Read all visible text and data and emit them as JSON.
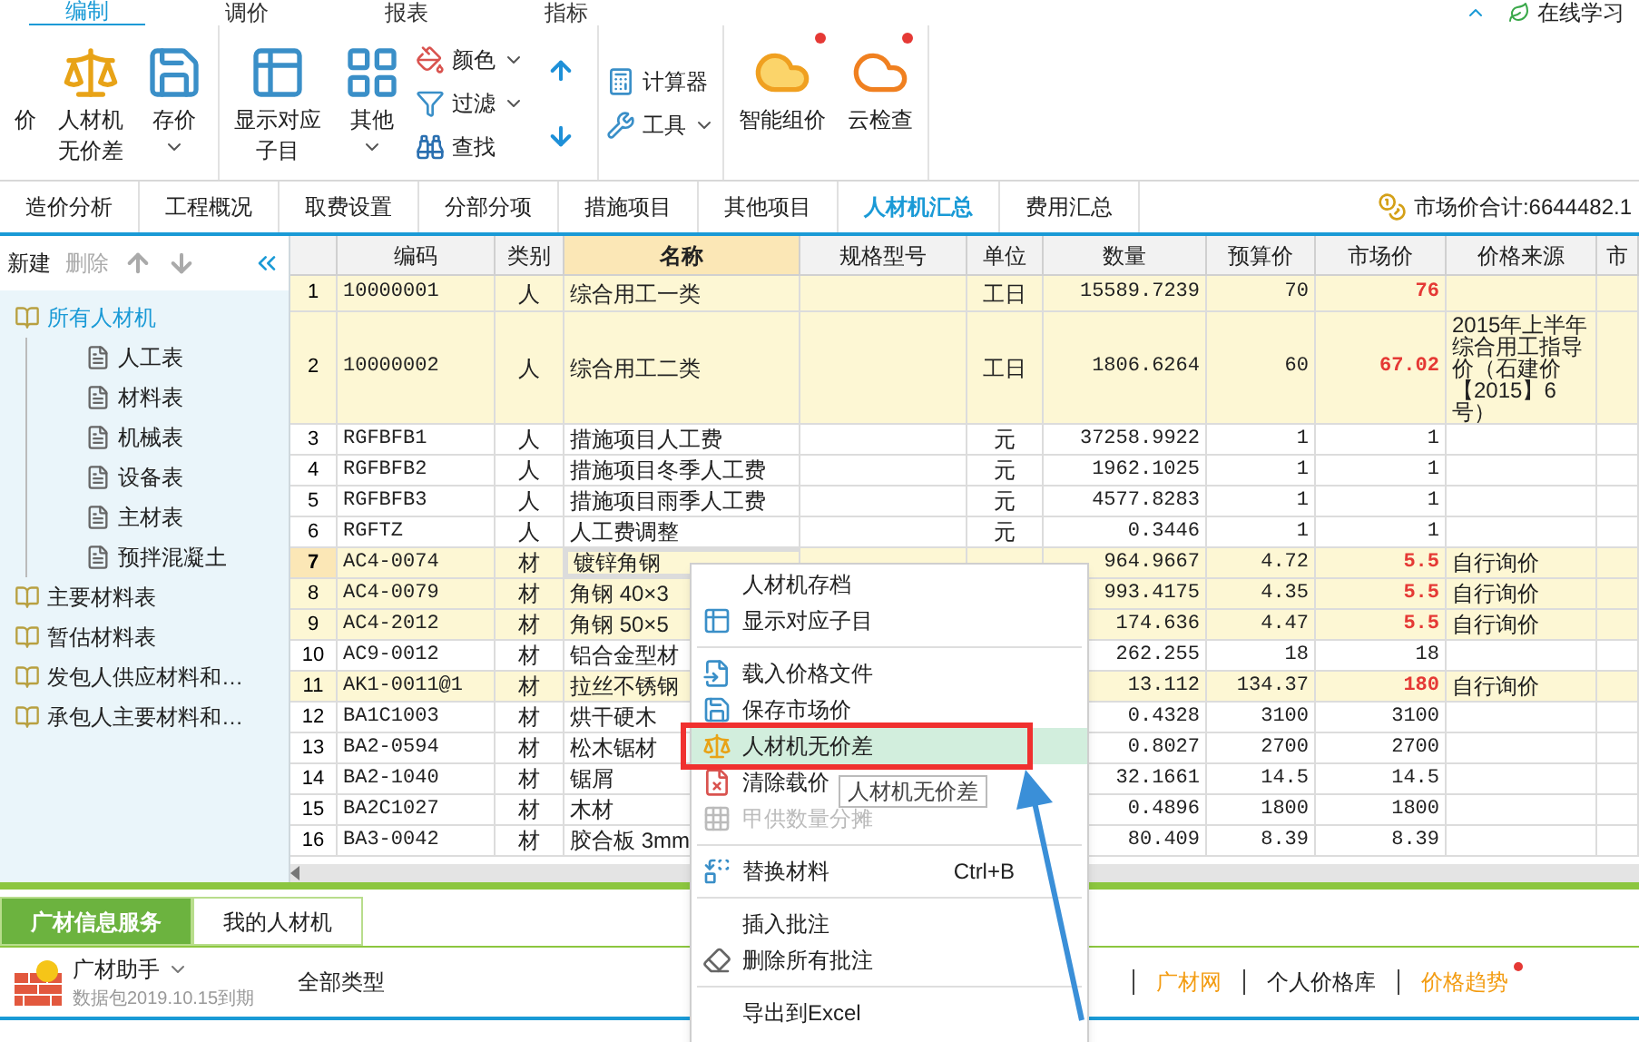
{
  "top_tabs": [
    {
      "label": "编制",
      "selected": true
    },
    {
      "label": "调价",
      "selected": false
    },
    {
      "label": "报表",
      "selected": false
    },
    {
      "label": "指标",
      "selected": false
    }
  ],
  "online_learning": "在线学习",
  "ribbon": {
    "groups": [
      {
        "items": [
          {
            "kind": "large",
            "label": "价"
          },
          {
            "kind": "large",
            "lines": [
              "人材机",
              "无价差"
            ]
          },
          {
            "kind": "large",
            "label": "存价",
            "dropdown": true
          }
        ]
      },
      {
        "items": [
          {
            "kind": "large",
            "lines": [
              "显示对应",
              "子目"
            ]
          },
          {
            "kind": "large",
            "label": "其他",
            "dropdown": true
          },
          {
            "kind": "stack",
            "items": [
              {
                "label": "颜色",
                "dropdown": true
              },
              {
                "label": "过滤",
                "dropdown": true
              },
              {
                "label": "查找",
                "dropdown": false
              }
            ]
          },
          {
            "kind": "arrows"
          }
        ]
      },
      {
        "items": [
          {
            "kind": "stack",
            "items": [
              {
                "label": "计算器",
                "dropdown": false
              },
              {
                "label": "工具",
                "dropdown": true
              }
            ]
          }
        ]
      },
      {
        "items": [
          {
            "kind": "large",
            "label": "智能组价",
            "badge": true
          },
          {
            "kind": "large",
            "label": "云检查",
            "badge": true
          }
        ]
      }
    ]
  },
  "nav_tabs": [
    {
      "label": "造价分析",
      "selected": false
    },
    {
      "label": "工程概况",
      "selected": false
    },
    {
      "label": "取费设置",
      "selected": false
    },
    {
      "label": "分部分项",
      "selected": false
    },
    {
      "label": "措施项目",
      "selected": false
    },
    {
      "label": "其他项目",
      "selected": false
    },
    {
      "label": "人材机汇总",
      "selected": true
    },
    {
      "label": "费用汇总",
      "selected": false
    }
  ],
  "market_total": "市场价合计:6644482.1",
  "sidebar": {
    "toolbar": [
      {
        "label": "新建",
        "disabled": false
      },
      {
        "label": "删除",
        "disabled": true
      }
    ],
    "tree": [
      {
        "label": "所有人材机",
        "selected": true,
        "children": [
          {
            "label": "人工表",
            "selected": false
          },
          {
            "label": "材料表",
            "selected": false
          },
          {
            "label": "机械表",
            "selected": false
          },
          {
            "label": "设备表",
            "selected": false
          },
          {
            "label": "主材表",
            "selected": false
          },
          {
            "label": "预拌混凝土",
            "selected": false
          }
        ]
      },
      {
        "label": "主要材料表",
        "selected": false
      },
      {
        "label": "暂估材料表",
        "selected": false
      },
      {
        "label": "发包人供应材料和…",
        "selected": false
      },
      {
        "label": "承包人主要材料和…",
        "selected": false
      }
    ]
  },
  "table": {
    "columns": [
      "编码",
      "类别",
      "名称",
      "规格型号",
      "单位",
      "数量",
      "预算价",
      "市场价",
      "价格来源",
      "市"
    ],
    "rows": [
      {
        "no": "1",
        "code": "10000001",
        "type": "人",
        "name": "综合用工一类",
        "unit": "工日",
        "qty": "15589.7239",
        "budget": "70",
        "market": "76",
        "highlighted": true,
        "selected": false
      },
      {
        "no": "2",
        "code": "10000002",
        "type": "人",
        "name": "综合用工二类",
        "unit": "工日",
        "qty": "1806.6264",
        "budget": "60",
        "market": "67.02",
        "source": "2015年上半年综合用工指导价（石建价【2015】6号）",
        "highlighted": true,
        "selected": false
      },
      {
        "no": "3",
        "code": "RGFBFB1",
        "type": "人",
        "name": "措施项目人工费",
        "unit": "元",
        "qty": "37258.9922",
        "budget": "1",
        "market": "1",
        "highlighted": false,
        "selected": false
      },
      {
        "no": "4",
        "code": "RGFBFB2",
        "type": "人",
        "name": "措施项目冬季人工费",
        "unit": "元",
        "qty": "1962.1025",
        "budget": "1",
        "market": "1",
        "highlighted": false,
        "selected": false
      },
      {
        "no": "5",
        "code": "RGFBFB3",
        "type": "人",
        "name": "措施项目雨季人工费",
        "unit": "元",
        "qty": "4577.8283",
        "budget": "1",
        "market": "1",
        "highlighted": false,
        "selected": false
      },
      {
        "no": "6",
        "code": "RGFTZ",
        "type": "人",
        "name": "人工费调整",
        "unit": "元",
        "qty": "0.3446",
        "budget": "1",
        "market": "1",
        "highlighted": false,
        "selected": false
      },
      {
        "no": "7",
        "code": "AC4-0074",
        "type": "材",
        "name": "镀锌角钢",
        "qty": "964.9667",
        "budget": "4.72",
        "market": "5.5",
        "source": "自行询价",
        "highlighted": true,
        "selected": true
      },
      {
        "no": "8",
        "code": "AC4-0079",
        "type": "材",
        "name": "角钢 40×3",
        "qty": "993.4175",
        "budget": "4.35",
        "market": "5.5",
        "source": "自行询价",
        "highlighted": true,
        "selected": false
      },
      {
        "no": "9",
        "code": "AC4-2012",
        "type": "材",
        "name": "角钢 50×5",
        "qty": "174.636",
        "budget": "4.47",
        "market": "5.5",
        "source": "自行询价",
        "highlighted": true,
        "selected": false
      },
      {
        "no": "10",
        "code": "AC9-0012",
        "type": "材",
        "name": "铝合金型材",
        "qty": "262.255",
        "budget": "18",
        "market": "18",
        "highlighted": false,
        "selected": false
      },
      {
        "no": "11",
        "code": "AK1-0011@1",
        "type": "材",
        "name": "拉丝不锈钢",
        "qty": "13.112",
        "budget": "134.37",
        "market": "180",
        "source": "自行询价",
        "highlighted": true,
        "selected": false
      },
      {
        "no": "12",
        "code": "BA1C1003",
        "type": "材",
        "name": "烘干硬木",
        "qty": "0.4328",
        "budget": "3100",
        "market": "3100",
        "highlighted": false,
        "selected": false
      },
      {
        "no": "13",
        "code": "BA2-0594",
        "type": "材",
        "name": "松木锯材",
        "qty": "0.8027",
        "budget": "2700",
        "market": "2700",
        "highlighted": false,
        "selected": false
      },
      {
        "no": "14",
        "code": "BA2-1040",
        "type": "材",
        "name": "锯屑",
        "qty": "32.1661",
        "budget": "14.5",
        "market": "14.5",
        "highlighted": false,
        "selected": false
      },
      {
        "no": "15",
        "code": "BA2C1027",
        "type": "材",
        "name": "木材",
        "qty": "0.4896",
        "budget": "1800",
        "market": "1800",
        "highlighted": false,
        "selected": false
      },
      {
        "no": "16",
        "code": "BA3-0042",
        "type": "材",
        "name": "胶合板 3mm",
        "qty": "80.409",
        "budget": "8.39",
        "market": "8.39",
        "highlighted": false,
        "selected": false
      }
    ]
  },
  "bottom_panel": {
    "tabs": [
      {
        "label": "广材信息服务",
        "selected": true
      },
      {
        "label": "我的人材机",
        "selected": false
      }
    ],
    "assistant": {
      "title": "广材助手",
      "subtitle": "数据包2019.10.15到期"
    },
    "type_filter": "全部类型",
    "links": [
      {
        "label": "广材网",
        "color": "#f39c12",
        "badge": false
      },
      {
        "label": "个人价格库",
        "color": "#222222",
        "badge": false
      },
      {
        "label": "价格趋势",
        "color": "#f39c12",
        "badge": true
      }
    ]
  },
  "context_menu": {
    "items": [
      {
        "kind": "item",
        "label": "人材机存档",
        "disabled": false,
        "selected": false
      },
      {
        "kind": "item",
        "label": "显示对应子目",
        "disabled": false,
        "selected": false
      },
      {
        "kind": "separator"
      },
      {
        "kind": "item",
        "label": "载入价格文件",
        "disabled": false,
        "selected": false
      },
      {
        "kind": "item",
        "label": "保存市场价",
        "disabled": false,
        "selected": false
      },
      {
        "kind": "item",
        "label": "人材机无价差",
        "disabled": false,
        "selected": true
      },
      {
        "kind": "item",
        "label": "清除载价",
        "disabled": false,
        "selected": false
      },
      {
        "kind": "item",
        "label": "甲供数量分摊",
        "disabled": true,
        "selected": false
      },
      {
        "kind": "separator"
      },
      {
        "kind": "item",
        "label": "替换材料",
        "shortcut": "Ctrl+B",
        "disabled": false,
        "selected": false
      },
      {
        "kind": "separator"
      },
      {
        "kind": "item",
        "label": "插入批注",
        "disabled": false,
        "selected": false
      },
      {
        "kind": "item",
        "label": "删除所有批注",
        "disabled": false,
        "selected": false
      },
      {
        "kind": "separator"
      },
      {
        "kind": "item",
        "label": "导出到Excel",
        "disabled": false,
        "selected": false
      }
    ],
    "tooltip": "人材机无价差"
  }
}
